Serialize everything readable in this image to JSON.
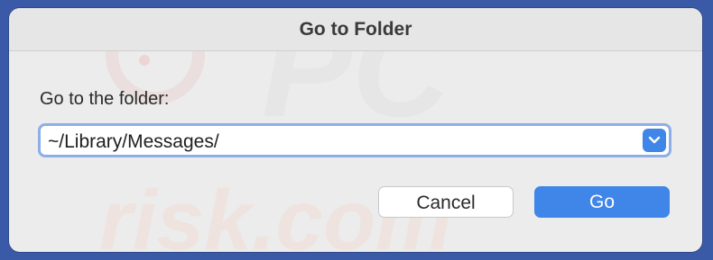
{
  "dialog": {
    "title": "Go to Folder",
    "prompt_label": "Go to the folder:",
    "path_value": "~/Library/Messages/",
    "cancel_label": "Cancel",
    "go_label": "Go"
  },
  "icons": {
    "dropdown": "chevron-down-icon"
  },
  "colors": {
    "accent": "#3f86e8",
    "focus_ring": "#8eaee8",
    "dialog_bg": "#ececec"
  }
}
